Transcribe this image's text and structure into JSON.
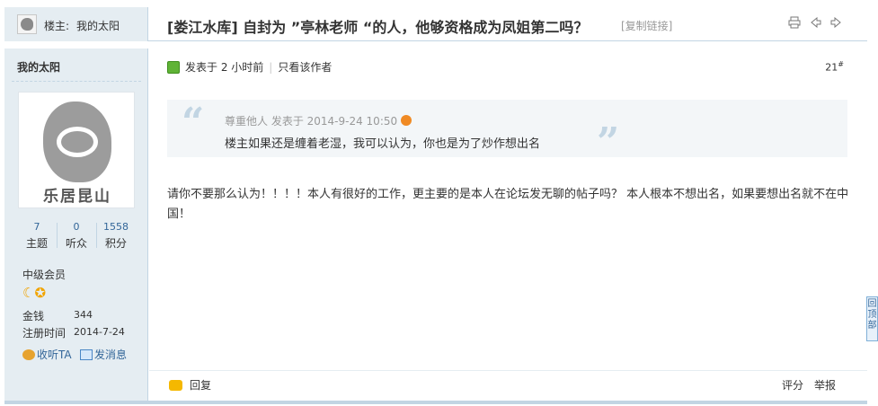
{
  "header": {
    "op_label": "楼主:",
    "op_name": "我的太阳",
    "category": "[娄江水库]",
    "title": "自封为 ”亭林老师 “的人，他够资格成为凤姐第二吗？",
    "copy_link": "[复制链接]",
    "icons": [
      "print-icon",
      "prev-thread-icon",
      "next-thread-icon"
    ]
  },
  "author": {
    "name": "我的太阳",
    "avatar_caption": "乐居昆山",
    "stats": [
      {
        "value": "7",
        "label": "主题"
      },
      {
        "value": "0",
        "label": "听众"
      },
      {
        "value": "1558",
        "label": "积分"
      }
    ],
    "group": "中级会员",
    "rank_icons": "☾✪",
    "money_label": "金钱",
    "money_value": "344",
    "reg_label": "注册时间",
    "reg_value": "2014-7-24",
    "follow": "收听TA",
    "message": "发消息"
  },
  "post": {
    "posted": "发表于 2 小时前",
    "author_only": "只看该作者",
    "floor": "21",
    "floor_sup": "#",
    "quote_head": "尊重他人 发表于 2014-9-24 10:50",
    "quote_body": "楼主如果还是缠着老湿，我可以认为，你也是为了炒作想出名",
    "content": "请你不要那么认为！！！！本人有很好的工作，更主要的是本人在论坛发无聊的帖子吗？  本人根本不想出名，如果要想出名就不在中国！",
    "reply": "回复",
    "rate": "评分",
    "report": "举报"
  },
  "sidebar_widget": {
    "back_top": "回顶部"
  }
}
